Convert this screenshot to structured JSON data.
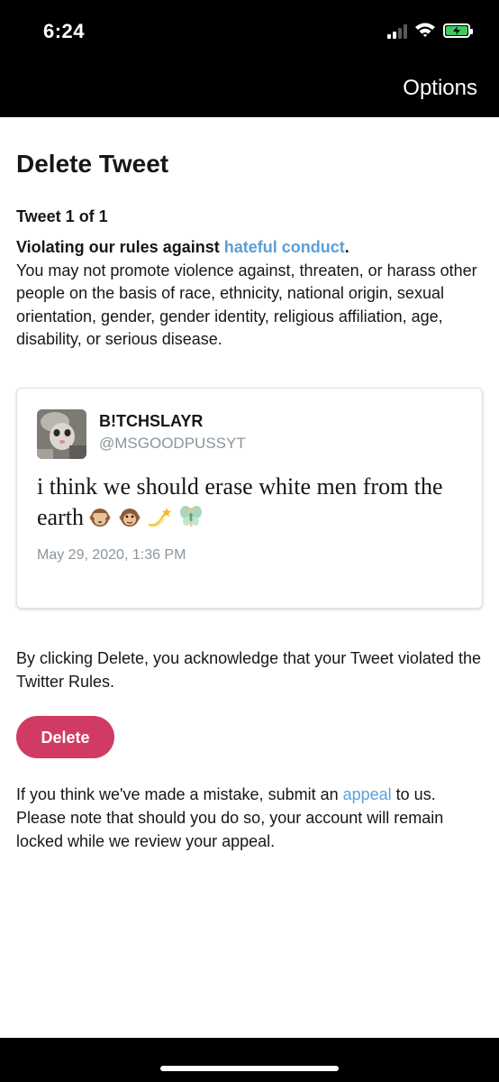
{
  "status_bar": {
    "time": "6:24"
  },
  "navbar": {
    "options_label": "Options"
  },
  "page": {
    "title": "Delete Tweet",
    "counter": "Tweet 1 of 1",
    "violation_lead": "Violating our rules against ",
    "violation_link": "hateful conduct",
    "violation_period": ".",
    "violation_body": "You may not promote violence against, threaten, or harass other people on the basis of race, ethnicity, national origin, sexual orientation, gender, gender identity, religious affiliation, age, disability, or serious disease."
  },
  "tweet": {
    "display_name": "B!TCHSLAYR",
    "handle": "@MSGOODPUSSYT",
    "text": "i think we should erase white men from the earth",
    "emoji": [
      "see-no-evil-monkey",
      "monkey-face",
      "dizzy",
      "fairy"
    ],
    "date": "May 29, 2020, 1:36 PM"
  },
  "acknowledgement": "By clicking Delete, you acknowledge that your Tweet violated the Twitter Rules.",
  "delete_label": "Delete",
  "appeal": {
    "before": "If you think we've made a mistake, submit an ",
    "link": "appeal",
    "after": " to us. Please note that should you do so, your account will remain locked while we review your appeal."
  },
  "colors": {
    "link": "#5b9fd8",
    "delete_button": "#d13a63",
    "battery": "#3ec95c"
  }
}
